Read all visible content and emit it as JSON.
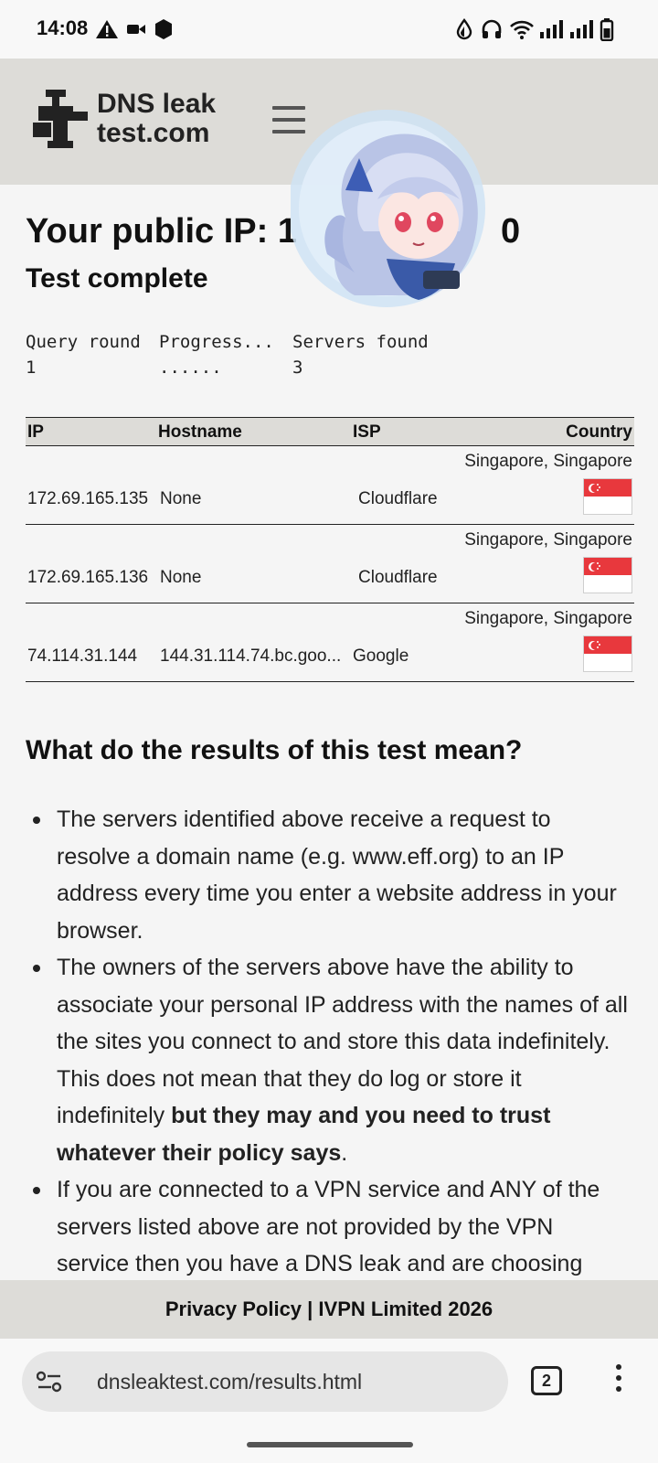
{
  "status_bar": {
    "time": "14:08"
  },
  "header": {
    "logo_line1": "DNS leak",
    "logo_line2": "test.com"
  },
  "main": {
    "title": "Your public IP: 1",
    "title_tail": "0",
    "subtitle": "Test complete",
    "query": {
      "headers": [
        "Query round",
        "Progress...",
        "Servers found"
      ],
      "values": [
        "1",
        "......",
        "3"
      ]
    },
    "results": {
      "columns": [
        "IP",
        "Hostname",
        "ISP",
        "Country"
      ],
      "rows": [
        {
          "ip": "172.69.165.135",
          "hostname": "None",
          "isp": "Cloudflare",
          "country": "Singapore, Singapore"
        },
        {
          "ip": "172.69.165.136",
          "hostname": "None",
          "isp": "Cloudflare",
          "country": "Singapore, Singapore"
        },
        {
          "ip": "74.114.31.144",
          "hostname": "144.31.114.74.bc.goo...",
          "isp": "Google",
          "country": "Singapore, Singapore"
        }
      ]
    },
    "section_title": "What do the results of this test mean?",
    "bullets": [
      {
        "text": "The servers identified above receive a request to resolve a domain name (e.g. www.eff.org) to an IP address every time you enter a website address in your browser."
      },
      {
        "text": "The owners of the servers above have the ability to associate your personal IP address with the names of all the sites you connect to and store this data indefinitely. This does not mean that they do log or store it indefinitely ",
        "bold": "but they may and you need to trust whatever their policy says",
        "tail": "."
      },
      {
        "text": "If you are connected to a VPN service and ANY of the servers listed above are not provided by the VPN service then you have a DNS leak and are choosing"
      }
    ]
  },
  "footer": {
    "text": "Privacy Policy | IVPN Limited 2026"
  },
  "browser": {
    "url": "dnsleaktest.com/results.html",
    "tab_count": "2"
  },
  "colors": {
    "header_bg": "#dddcd8",
    "flag_red": "#e8383d",
    "page_bg": "#f5f5f5"
  }
}
